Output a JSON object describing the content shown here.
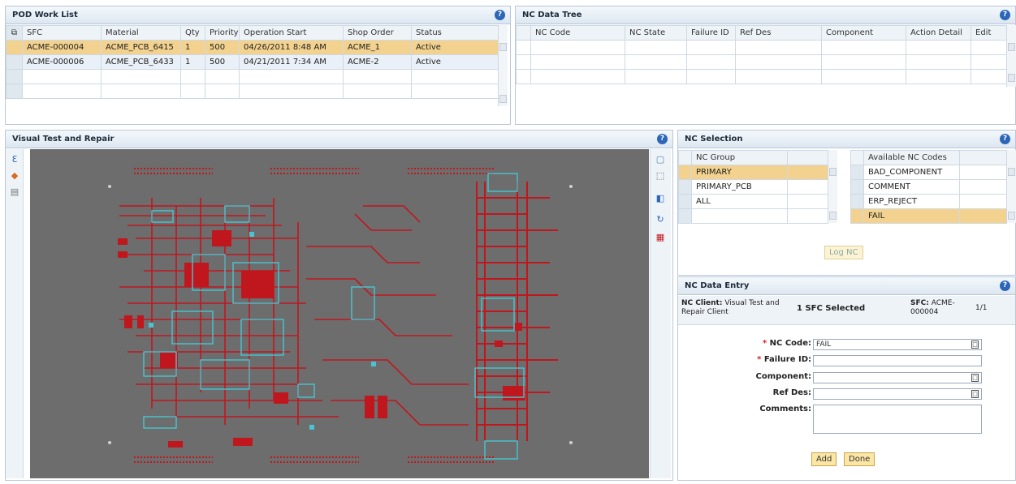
{
  "work_list": {
    "title": "POD Work List",
    "columns": [
      "SFC",
      "Material",
      "Qty",
      "Priority",
      "Operation Start",
      "Shop Order",
      "Status"
    ],
    "rows": [
      [
        "ACME-000004",
        "ACME_PCB_6415",
        "1",
        "500",
        "04/26/2011 8:48 AM",
        "ACME_1",
        "Active"
      ],
      [
        "ACME-000006",
        "ACME_PCB_6433",
        "1",
        "500",
        "04/21/2011 7:34 AM",
        "ACME-2",
        "Active"
      ]
    ]
  },
  "nc_tree": {
    "title": "NC Data Tree",
    "columns": [
      "NC Code",
      "NC State",
      "Failure ID",
      "Ref Des",
      "Component",
      "Action Detail",
      "Edit"
    ]
  },
  "vtr": {
    "title": "Visual Test and Repair"
  },
  "nc_selection": {
    "title": "NC Selection",
    "group_header": "NC Group",
    "groups": [
      "PRIMARY",
      "PRIMARY_PCB",
      "ALL"
    ],
    "codes_header": "Available NC Codes",
    "codes": [
      "BAD_COMPONENT",
      "COMMENT",
      "ERP_REJECT",
      "FAIL"
    ],
    "log_button": "Log NC"
  },
  "nc_entry": {
    "title": "NC Data Entry",
    "client_label": "NC Client:",
    "client_value": "Visual Test and Repair Client",
    "sfc_selected": "1 SFC Selected",
    "sfc_label": "SFC:",
    "sfc_value": "ACME-000004",
    "counter": "1/1",
    "nc_code_label": "NC Code:",
    "nc_code_value": "FAIL",
    "failure_id_label": "Failure ID:",
    "component_label": "Component:",
    "ref_des_label": "Ref Des:",
    "comments_label": "Comments:",
    "add_button": "Add",
    "done_button": "Done"
  },
  "colors": {
    "header_bg": "#dde7f1",
    "selected_row": "#f3d28f",
    "board_bg": "#6d6d6d",
    "trace_red": "#c0171e",
    "trace_cyan": "#47c6d2"
  }
}
